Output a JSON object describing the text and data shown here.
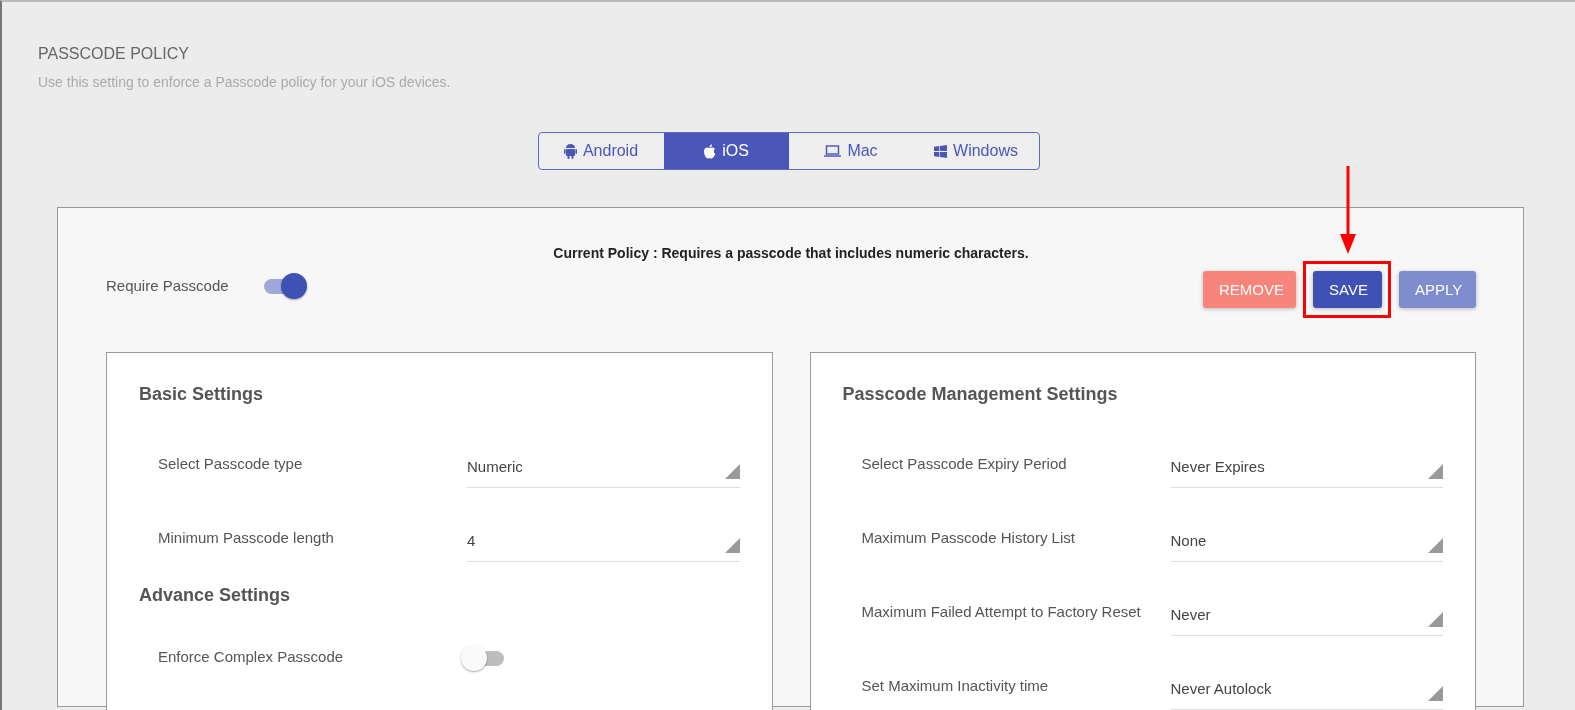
{
  "header": {
    "title": "PASSCODE POLICY",
    "description": "Use this setting to enforce a Passcode policy for your iOS devices."
  },
  "platform_tabs": [
    {
      "label": "Android",
      "kind": "android",
      "selected": false
    },
    {
      "label": "iOS",
      "kind": "apple",
      "selected": true
    },
    {
      "label": "Mac",
      "kind": "laptop",
      "selected": false
    },
    {
      "label": "Windows",
      "kind": "windows",
      "selected": false
    }
  ],
  "policy": {
    "current_policy": "Current Policy : Requires a passcode that includes numeric characters.",
    "require_passcode": {
      "label": "Require Passcode",
      "on": true
    },
    "buttons": [
      {
        "label": "REMOVE",
        "kind": "danger",
        "highlighted": false
      },
      {
        "label": "SAVE",
        "kind": "primary",
        "highlighted": true
      },
      {
        "label": "APPLY",
        "kind": "secondary",
        "highlighted": false
      }
    ]
  },
  "panels": [
    {
      "items": [
        {
          "kind": "heading",
          "label": "Basic Settings"
        },
        {
          "kind": "select",
          "label": "Select Passcode type",
          "value": "Numeric"
        },
        {
          "kind": "select",
          "label": "Minimum Passcode length",
          "value": "4"
        },
        {
          "kind": "heading",
          "label": "Advance Settings"
        },
        {
          "kind": "toggle",
          "label": "Enforce Complex Passcode",
          "on": false
        }
      ]
    },
    {
      "items": [
        {
          "kind": "heading",
          "label": "Passcode Management Settings"
        },
        {
          "kind": "select",
          "label": "Select Passcode Expiry Period",
          "value": "Never Expires"
        },
        {
          "kind": "select",
          "label": "Maximum Passcode History List",
          "value": "None"
        },
        {
          "kind": "select",
          "label": "Maximum Failed Attempt to Factory Reset",
          "value": "Never"
        },
        {
          "kind": "select",
          "label": "Set Maximum Inactivity time",
          "value": "Never Autolock"
        }
      ]
    }
  ]
}
